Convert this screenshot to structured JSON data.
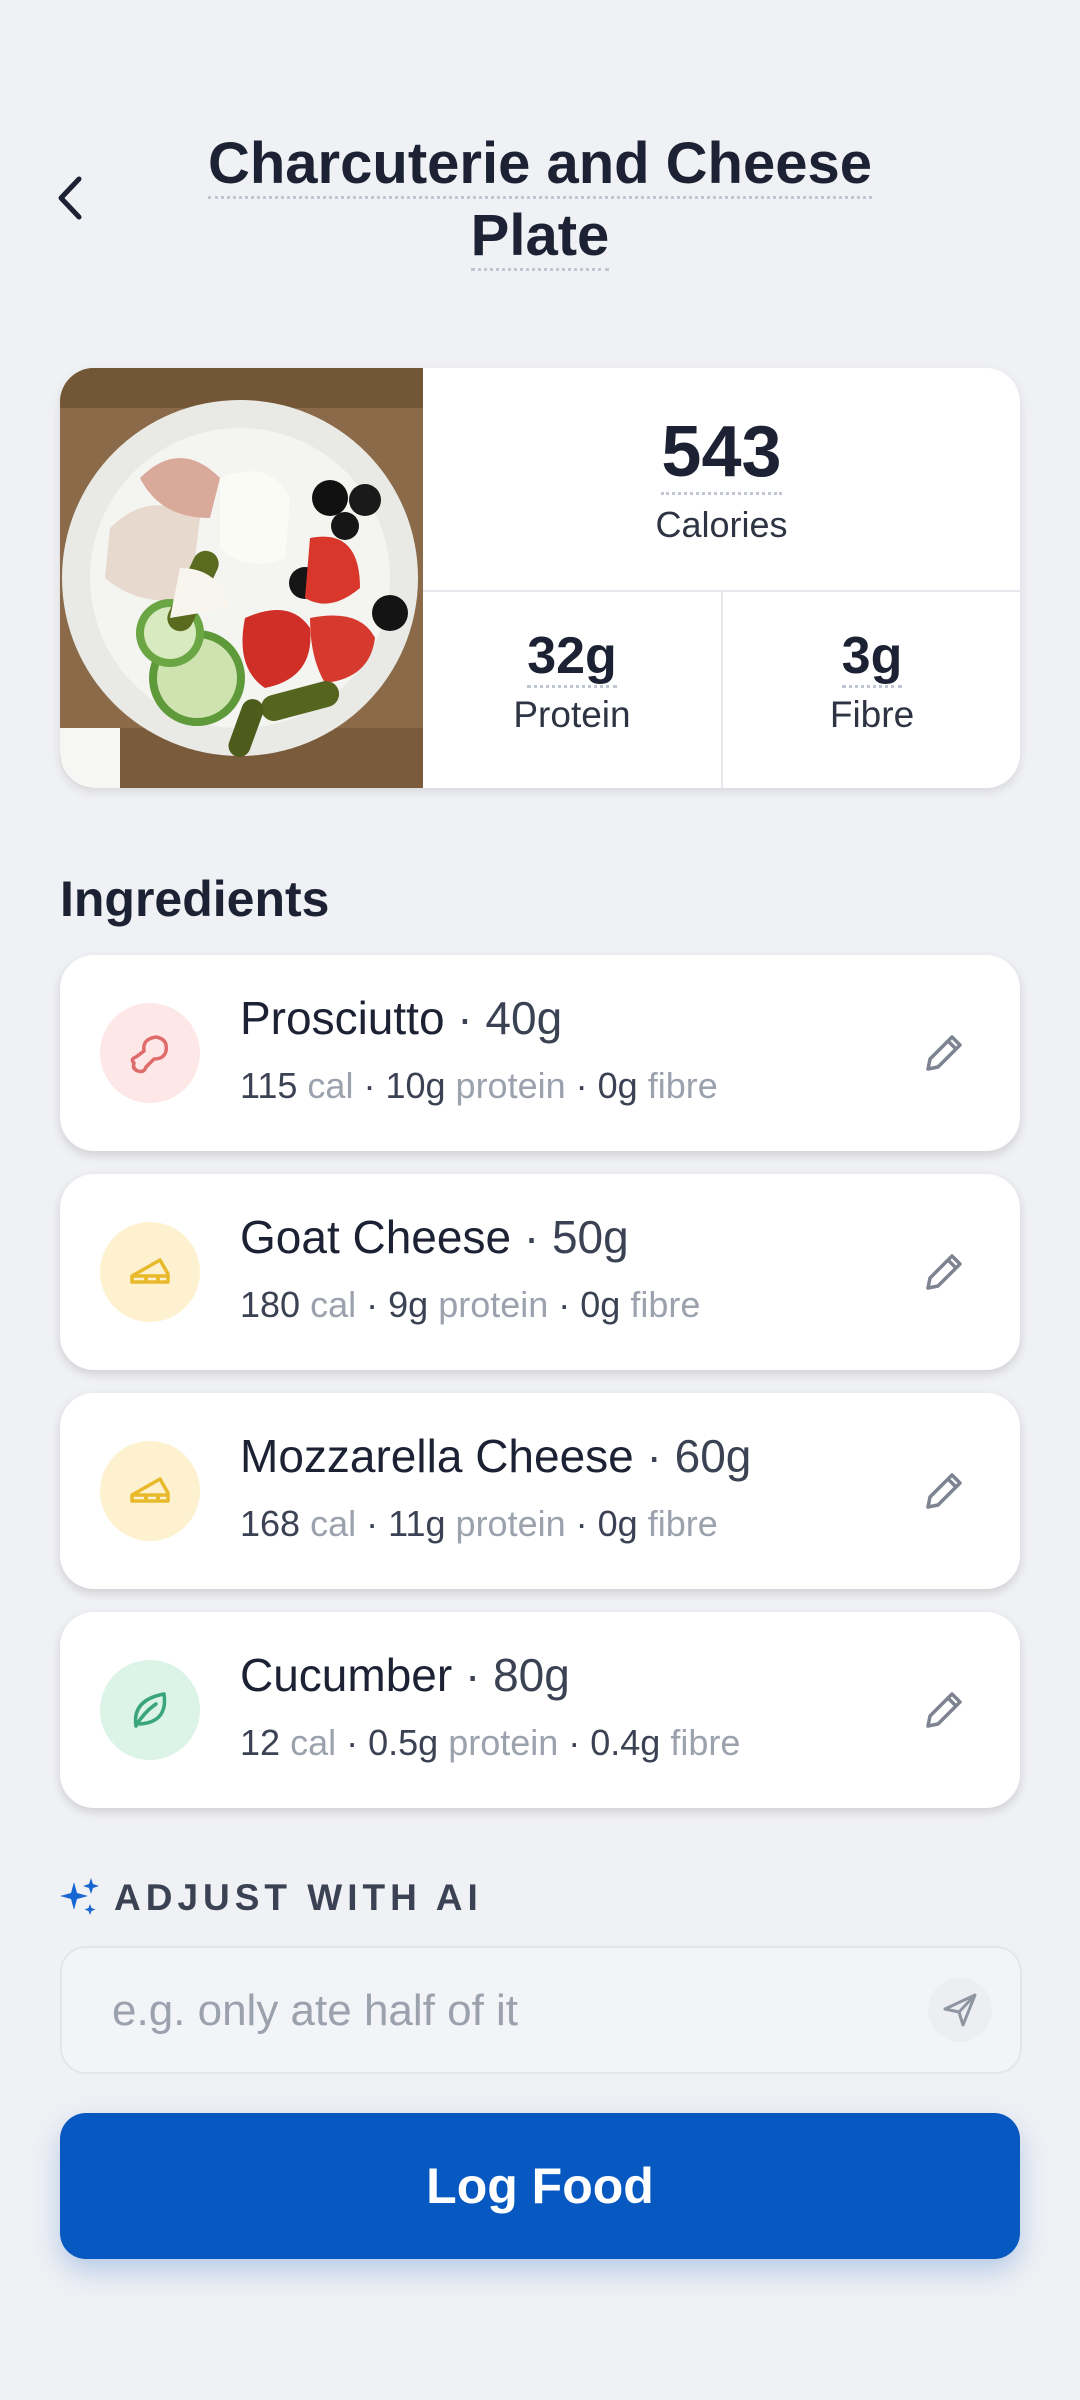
{
  "header": {
    "title": "Charcuterie and Cheese Plate",
    "back_icon": "chevron-left-icon"
  },
  "summary": {
    "calories_value": "543",
    "calories_label": "Calories",
    "protein_value": "32g",
    "protein_label": "Protein",
    "fibre_value": "3g",
    "fibre_label": "Fibre"
  },
  "ingredients_title": "Ingredients",
  "ingredients": [
    {
      "name": "Prosciutto",
      "qty": "40g",
      "cal": "115",
      "protein": "10g",
      "fibre": "0g",
      "icon": "meat-icon",
      "icon_bg": "#fde7e7",
      "icon_color": "#e06b6b"
    },
    {
      "name": "Goat Cheese",
      "qty": "50g",
      "cal": "180",
      "protein": "9g",
      "fibre": "0g",
      "icon": "cheese-icon",
      "icon_bg": "#fdf1cf",
      "icon_color": "#e8b92a"
    },
    {
      "name": "Mozzarella Cheese",
      "qty": "60g",
      "cal": "168",
      "protein": "11g",
      "fibre": "0g",
      "icon": "cheese-icon",
      "icon_bg": "#fdf1cf",
      "icon_color": "#e8b92a"
    },
    {
      "name": "Cucumber",
      "qty": "80g",
      "cal": "12",
      "protein": "0.5g",
      "fibre": "0.4g",
      "icon": "leaf-icon",
      "icon_bg": "#dcf3e8",
      "icon_color": "#3aa57a"
    }
  ],
  "units": {
    "cal": "cal",
    "protein": "protein",
    "fibre": "fibre",
    "sep": " · "
  },
  "ai": {
    "label": "ADJUST WITH AI",
    "placeholder": "e.g. only ate half of it"
  },
  "log_button": "Log Food",
  "colors": {
    "accent": "#0758c0",
    "background": "#f0f1f5"
  }
}
